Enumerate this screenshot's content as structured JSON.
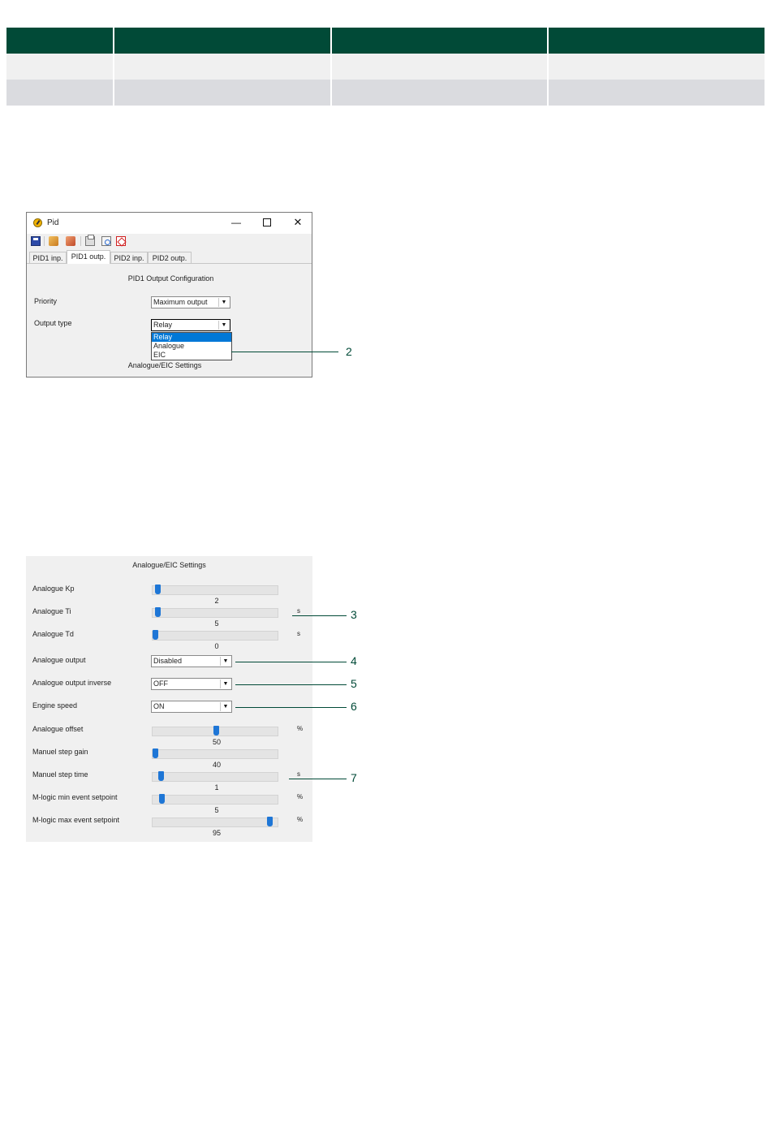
{
  "top_table": {
    "rows": 3,
    "cols": 4
  },
  "pid_window": {
    "title": "Pid",
    "controls": {
      "minimize": "—",
      "maximize": "",
      "close": "✕"
    },
    "toolbar_icons": [
      "save-icon",
      "read-icon",
      "write-icon",
      "print-icon",
      "preview-icon",
      "pdf-icon"
    ],
    "tabs": [
      "PID1 inp.",
      "PID1 outp.",
      "PID2 inp.",
      "PID2 outp."
    ],
    "active_tab": "PID1 outp.",
    "config_title": "PID1 Output Configuration",
    "priority_label": "Priority",
    "priority_value": "Maximum output",
    "output_type_label": "Output type",
    "output_type_value": "Relay",
    "output_type_options": [
      "Relay",
      "Analogue",
      "EIC"
    ],
    "footer_text": "Analogue/EIC Settings",
    "arrow": "▼"
  },
  "callouts": [
    "2",
    "3",
    "4",
    "5",
    "6",
    "7"
  ],
  "settings_panel": {
    "title": "Analogue/EIC Settings",
    "sliders": [
      {
        "label": "Analogue Kp",
        "value": "2",
        "unit": "",
        "level": 0.02
      },
      {
        "label": "Analogue Ti",
        "value": "5",
        "unit": "s",
        "level": 0.02
      },
      {
        "label": "Analogue Td",
        "value": "0",
        "unit": "s",
        "level": 0.0
      }
    ],
    "combos": [
      {
        "label": "Analogue output",
        "value": "Disabled"
      },
      {
        "label": "Analogue output inverse",
        "value": "OFF"
      },
      {
        "label": "Engine speed",
        "value": "ON"
      }
    ],
    "sliders2": [
      {
        "label": "Analogue offset",
        "value": "50",
        "unit": "%",
        "level": 0.5
      },
      {
        "label": "Manuel step gain",
        "value": "40",
        "unit": "",
        "level": 0.0
      },
      {
        "label": "Manuel step time",
        "value": "1",
        "unit": "s",
        "level": 0.05
      },
      {
        "label": "M-logic min event setpoint",
        "value": "5",
        "unit": "%",
        "level": 0.05
      },
      {
        "label": "M-logic max event setpoint",
        "value": "95",
        "unit": "%",
        "level": 0.95
      }
    ]
  },
  "colors": {
    "accent": "#014a37",
    "selection": "#0078d7",
    "thumb": "#1e76d6"
  }
}
